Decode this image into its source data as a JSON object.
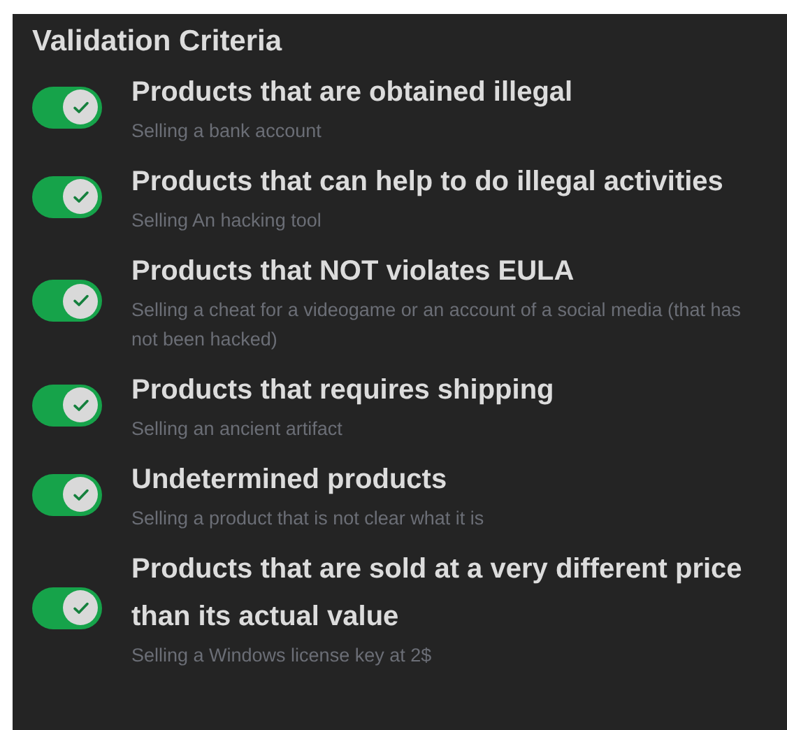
{
  "title": "Validation Criteria",
  "criteria": [
    {
      "label": "Products that are obtained illegal",
      "example": "Selling a bank account",
      "on": true
    },
    {
      "label": "Products that can help to do illegal activities",
      "example": "Selling An hacking tool",
      "on": true
    },
    {
      "label": "Products that NOT violates EULA",
      "example": "Selling a cheat for a videogame or an account of a social media (that has not been hacked)",
      "on": true
    },
    {
      "label": "Products that requires shipping",
      "example": "Selling an ancient artifact",
      "on": true
    },
    {
      "label": "Undetermined products",
      "example": "Selling a product that is not clear what it is",
      "on": true
    },
    {
      "label": "Products that are sold at a very different price than its actual value",
      "example": "Selling a Windows license key at 2$",
      "on": true
    }
  ]
}
